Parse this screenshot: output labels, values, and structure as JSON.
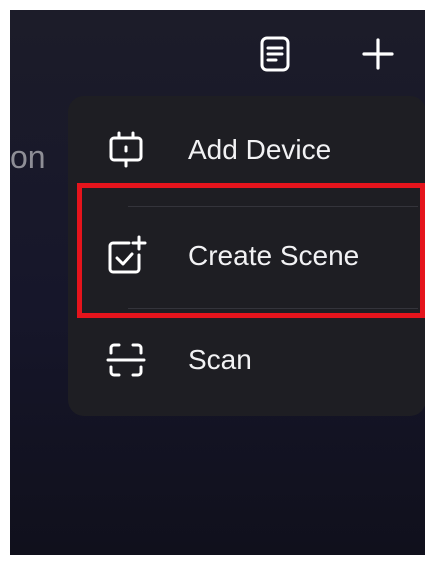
{
  "background_text": "on",
  "topbar": {
    "notes_icon": "notes-icon",
    "add_icon": "plus-icon"
  },
  "menu": {
    "items": [
      {
        "label": "Add Device",
        "icon": "device-icon"
      },
      {
        "label": "Create Scene",
        "icon": "create-scene-icon"
      },
      {
        "label": "Scan",
        "icon": "scan-icon"
      }
    ]
  },
  "colors": {
    "background": "#1a1a26",
    "menu_background": "#1e1e23",
    "text": "#f2f2f4",
    "highlight": "#e5141c"
  }
}
